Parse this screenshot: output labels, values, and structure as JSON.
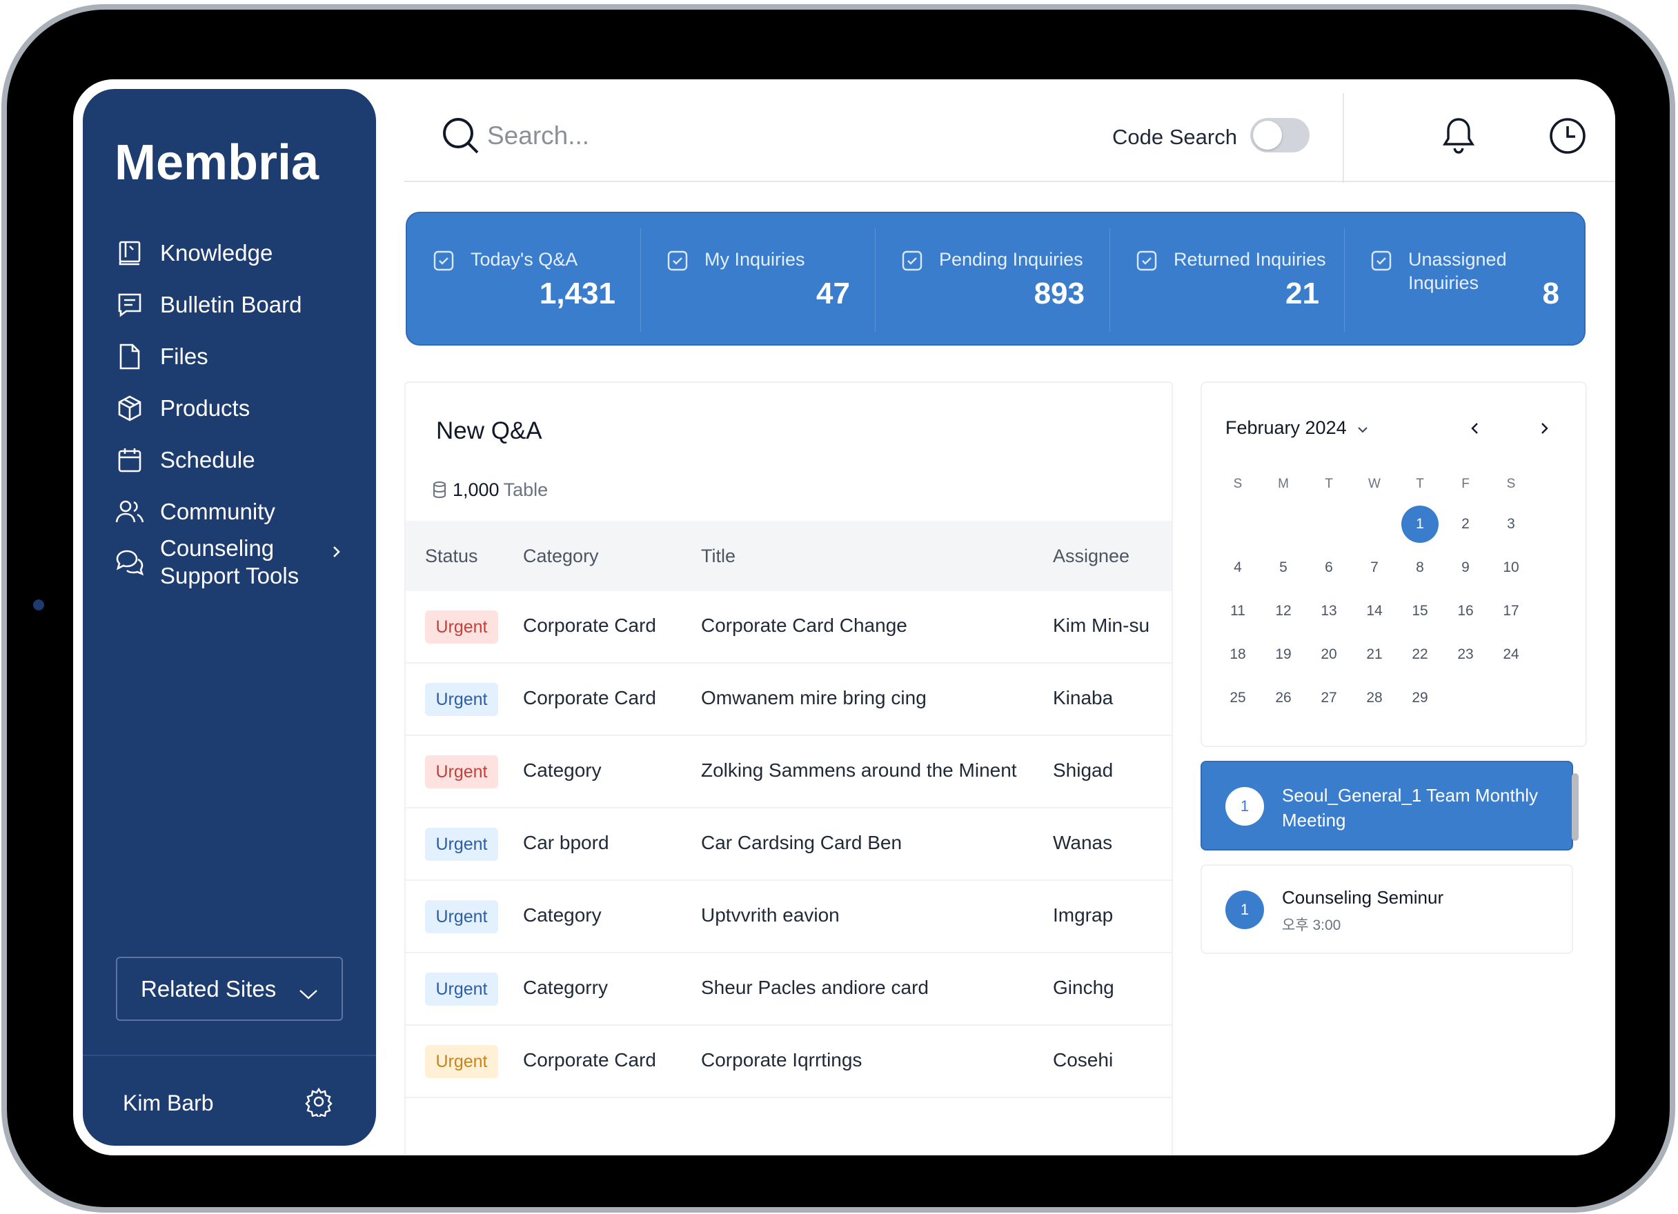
{
  "app": {
    "brand": "Membria"
  },
  "sidebar": {
    "items": [
      {
        "label": "Knowledge",
        "icon": "book-icon"
      },
      {
        "label": "Bulletin Board",
        "icon": "message-board-icon"
      },
      {
        "label": "Files",
        "icon": "file-icon"
      },
      {
        "label": "Products",
        "icon": "box-icon"
      },
      {
        "label": "Schedule",
        "icon": "calendar-icon"
      },
      {
        "label": "Community",
        "icon": "users-icon"
      },
      {
        "label": "Counseling Support Tools",
        "icon": "chat-bubbles-icon"
      }
    ],
    "related_sites": "Related Sites",
    "user_name": "Kim Barb"
  },
  "topbar": {
    "search_placeholder": "Search...",
    "code_search_label": "Code Search",
    "code_search_enabled": false
  },
  "stats": [
    {
      "label": "Today's Q&A",
      "value": "1,431"
    },
    {
      "label": "My Inquiries",
      "value": "47"
    },
    {
      "label": "Pending Inquiries",
      "value": "893"
    },
    {
      "label": "Returned Inquiries",
      "value": "21"
    },
    {
      "label": "Unassigned Inquiries",
      "value": "8"
    }
  ],
  "qa": {
    "title": "New Q&A",
    "count": "1,000",
    "count_unit": "Table",
    "columns": [
      "Status",
      "Category",
      "Title",
      "Assignee"
    ],
    "rows": [
      {
        "status": "Urgent",
        "status_color": "red",
        "category": "Corporate Card",
        "title": "Corporate Card Change",
        "assignee": "Kim Min-su"
      },
      {
        "status": "Urgent",
        "status_color": "blue",
        "category": "Corporate Card",
        "title": "Omwanem mire bring cing",
        "assignee": "Kinaba"
      },
      {
        "status": "Urgent",
        "status_color": "red",
        "category": "Category",
        "title": "Zolking Sammens around the Minent",
        "assignee": "Shigad"
      },
      {
        "status": "Urgent",
        "status_color": "blue",
        "category": "Car bpord",
        "title": "Car Cardsing Card Ben",
        "assignee": "Wanas"
      },
      {
        "status": "Urgent",
        "status_color": "blue",
        "category": "Category",
        "title": "Uptvvrith eavion",
        "assignee": "Imgrap"
      },
      {
        "status": "Urgent",
        "status_color": "blue",
        "category": "Categorry",
        "title": "Sheur Pacles andiore card",
        "assignee": "Ginchg"
      },
      {
        "status": "Urgent",
        "status_color": "amber",
        "category": "Corporate Card",
        "title": "Corporate Iqrrtings",
        "assignee": "Cosehi"
      }
    ],
    "badge_colors": {
      "red": "#fde2df",
      "blue": "#e2f1fd",
      "amber": "#fff0d6"
    }
  },
  "calendar": {
    "month_label": "February 2024",
    "weekdays": [
      "S",
      "M",
      "T",
      "W",
      "T",
      "F",
      "S"
    ],
    "first_weekday_index": 4,
    "days_in_month": 29,
    "selected_day": 1
  },
  "events": [
    {
      "badge": "1",
      "title": "Seoul_General_1 Team Monthly Meeting",
      "time": ""
    },
    {
      "badge": "1",
      "title": "Counseling Seminur",
      "time": "오후 3:00"
    }
  ],
  "colors": {
    "sidebar": "#1d3c70",
    "accent": "#3a7dcc"
  }
}
